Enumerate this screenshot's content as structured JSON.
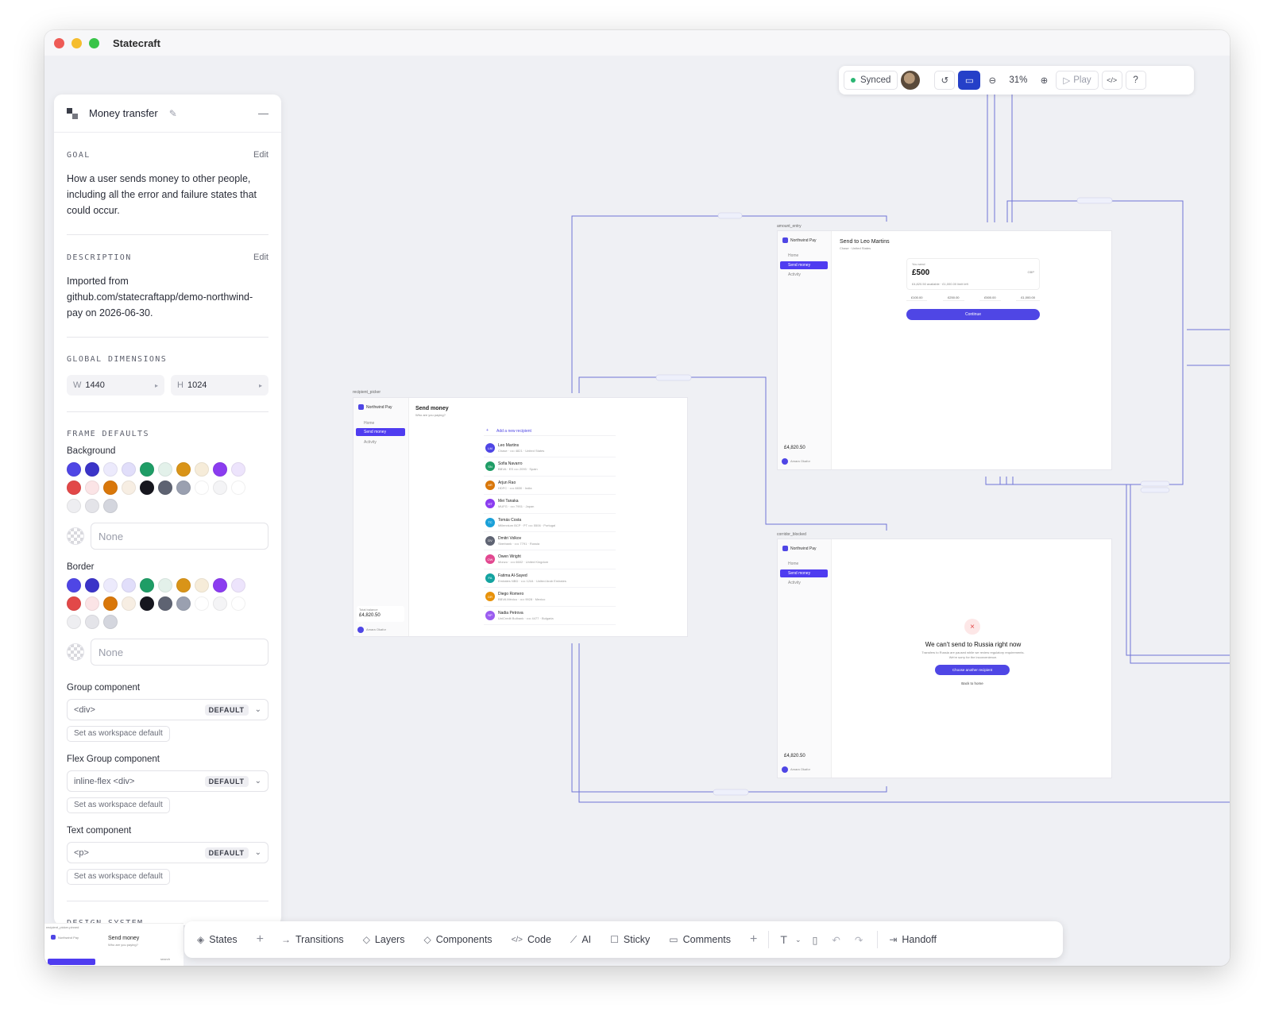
{
  "app": {
    "title": "Statecraft"
  },
  "panel": {
    "flow_title": "Money transfer",
    "goal": {
      "heading": "GOAL",
      "edit": "Edit",
      "text": "How a user sends money to other people, including all the error and failure states that could occur."
    },
    "description": {
      "heading": "DESCRIPTION",
      "edit": "Edit",
      "text": "Imported from github.com/statecraftapp/demo-northwind-pay on 2026-06-30."
    },
    "dimensions": {
      "heading": "GLOBAL DIMENSIONS",
      "w_label": "W",
      "w_value": "1440",
      "h_label": "H",
      "h_value": "1024"
    },
    "frame_defaults": {
      "heading": "FRAME DEFAULTS",
      "background_label": "Background",
      "border_label": "Border",
      "none_placeholder": "None",
      "swatch_colors": [
        "#4f46e5",
        "#3b34c8",
        "#eceafc",
        "#e1defa",
        "#1f9d66",
        "#e3f1ea",
        "#d99418",
        "#f6ecd9",
        "#8b3cf0",
        "#ede4fc",
        "#e24848",
        "#fbe4e6",
        "#d9770a",
        "#f7eee3",
        "#16161e",
        "#5e6372",
        "#9aa0b0",
        "#ffffff",
        "#f4f4f6",
        "#ffffff",
        "#eeeef1",
        "#e4e4e9",
        "#d4d6de"
      ]
    },
    "components": [
      {
        "label": "Group component",
        "value": "<div>",
        "badge": "DEFAULT",
        "action": "Set as workspace default"
      },
      {
        "label": "Flex Group component",
        "value": "inline-flex <div>",
        "badge": "DEFAULT",
        "action": "Set as workspace default"
      },
      {
        "label": "Text component",
        "value": "<p>",
        "badge": "DEFAULT",
        "action": "Set as workspace default"
      }
    ],
    "design_system_heading": "DESIGN SYSTEM"
  },
  "topbar": {
    "synced": "Synced",
    "zoom": "31%",
    "play": "Play",
    "help": "?"
  },
  "frames": {
    "picker": {
      "label": "recipient_picker",
      "brand": "Northwind Pay",
      "nav": [
        "Home",
        "Send money",
        "Activity"
      ],
      "title": "Send money",
      "subtitle": "Who are you paying?",
      "add": "Add a new recipient",
      "balance_label": "Total balance",
      "balance": "£4,820.50",
      "user": "Amara Okafor",
      "recipients": [
        {
          "initials": "LM",
          "name": "Leo Martins",
          "detail": "Chase · •••• 4821 · United States",
          "color": "#4f46e5"
        },
        {
          "initials": "SN",
          "name": "Sofia Navarro",
          "detail": "BBVA · ES •••• 2093 · Spain",
          "color": "#1f9d66"
        },
        {
          "initials": "AR",
          "name": "Arjun Rao",
          "detail": "HDFC · •••• 8830 · India",
          "color": "#d9770a"
        },
        {
          "initials": "MT",
          "name": "Mei Tanaka",
          "detail": "MUFG · •••• 7901 · Japan",
          "color": "#8b3cf0"
        },
        {
          "initials": "TC",
          "name": "Tomás Costa",
          "detail": "Millennium BCP · PT •••• 5506 · Portugal",
          "color": "#1aa0d8"
        },
        {
          "initials": "DV",
          "name": "Dmitri Volkov",
          "detail": "Sberbank · •••• 7791 · Russia",
          "color": "#5e6372"
        },
        {
          "initials": "OW",
          "name": "Owen Wright",
          "detail": "Monzo · •••• 6602 · United Kingdom",
          "color": "#e24890"
        },
        {
          "initials": "FA",
          "name": "Fatima Al-Sayed",
          "detail": "Emirates NBD · •••• 1244 · United Arab Emirates",
          "color": "#14a3a0"
        },
        {
          "initials": "DR",
          "name": "Diego Romero",
          "detail": "BBVA México · •••• 9928 · Mexico",
          "color": "#e8920a"
        },
        {
          "initials": "NP",
          "name": "Nadia Petrova",
          "detail": "UniCredit Bulbank · •••• 4477 · Bulgaria",
          "color": "#9b5cf0"
        }
      ]
    },
    "amount": {
      "label": "amount_entry",
      "title": "Send to Leo Martins",
      "subtitle": "Chase · United States",
      "you_send": "You send",
      "amount": "£500",
      "currency": "GBP",
      "available": "£4,820.50 available · £1,000.00 limit left",
      "quick": [
        "£100.00",
        "£250.00",
        "£500.00",
        "£1,000.00"
      ],
      "cta": "Continue",
      "balance": "£4,820.50",
      "user": "Amara Okafor"
    },
    "blocked": {
      "label": "corridor_blocked",
      "title": "We can't send to Russia right now",
      "text": "Transfers to Russia are paused while we review regulatory requirements. We're sorry for the inconvenience.",
      "primary": "Choose another recipient",
      "secondary": "Back to home",
      "balance": "£4,820.50",
      "user": "Amara Okafor"
    }
  },
  "bottombar": {
    "states": "States",
    "transitions": "Transitions",
    "layers": "Layers",
    "components": "Components",
    "code": "Code",
    "ai": "AI",
    "sticky": "Sticky",
    "comments": "Comments",
    "handoff": "Handoff"
  },
  "minithumb": {
    "label": "recipient_picker-pinned",
    "brand": "Northwind Pay",
    "title": "Send money",
    "subtitle": "Who are you paying?",
    "search": "search"
  }
}
